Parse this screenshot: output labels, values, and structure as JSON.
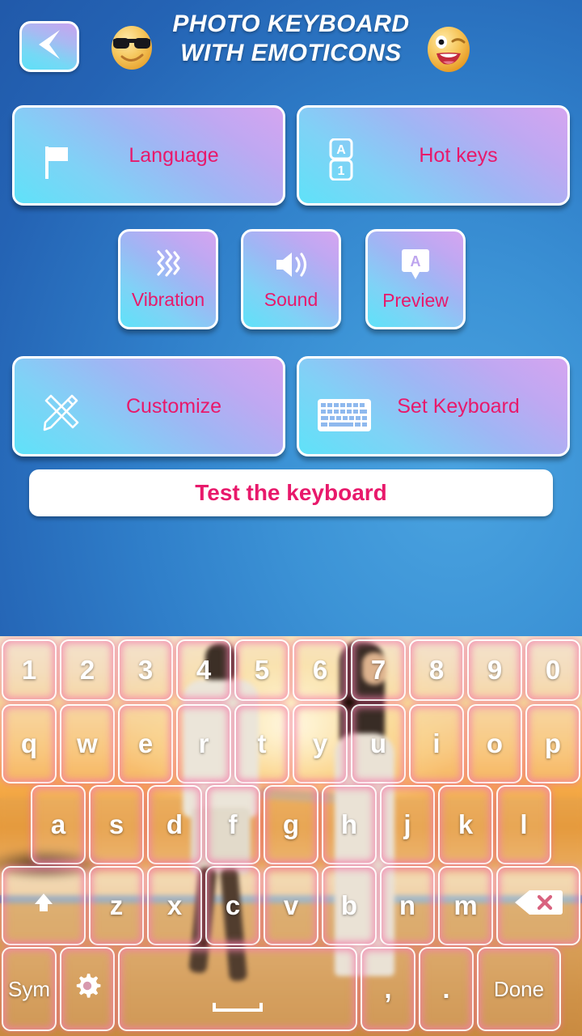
{
  "header": {
    "back_icon": "back-arrow-icon",
    "emoji_left": "sunglasses-face-emoji",
    "emoji_right": "winking-face-emoji",
    "title_line1": "PHOTO KEYBOARD",
    "title_line2": "WITH EMOTICONS"
  },
  "menu": {
    "language": {
      "label": "Language",
      "icon": "flag-icon"
    },
    "hot_keys": {
      "label": "Hot keys",
      "icon": "a1-keycap-icon"
    },
    "vibration": {
      "label": "Vibration",
      "icon": "vibration-waves-icon"
    },
    "sound": {
      "label": "Sound",
      "icon": "speaker-icon"
    },
    "preview": {
      "label": "Preview",
      "icon": "preview-popup-a-icon"
    },
    "customize": {
      "label": "Customize",
      "icon": "pencil-ruler-icon"
    },
    "set_keyboard": {
      "label": "Set Keyboard",
      "icon": "keyboard-icon"
    }
  },
  "test_field": {
    "value": "Test the keyboard",
    "placeholder": "Test the keyboard"
  },
  "keyboard": {
    "row_numbers": [
      "1",
      "2",
      "3",
      "4",
      "5",
      "6",
      "7",
      "8",
      "9",
      "0"
    ],
    "row_top": [
      "q",
      "w",
      "e",
      "r",
      "t",
      "y",
      "u",
      "i",
      "o",
      "p"
    ],
    "row_home": [
      "a",
      "s",
      "d",
      "f",
      "g",
      "h",
      "j",
      "k",
      "l"
    ],
    "row_bottom_letters": [
      "z",
      "x",
      "c",
      "v",
      "b",
      "n",
      "m"
    ],
    "shift_icon": "shift-arrow-icon",
    "backspace_icon": "backspace-delete-icon",
    "sym_label": "Sym",
    "gear_icon": "gear-icon",
    "space_label": "",
    "comma_label": ",",
    "period_label": ".",
    "done_label": "Done"
  },
  "colors": {
    "accent_pink": "#e8196b",
    "key_glow": "#f37eaa",
    "bg_blue_light": "#4aa3e0",
    "bg_blue_dark": "#1d4e9e",
    "button_violet": "#d5a5f0",
    "button_cyan": "#5fe2f8"
  }
}
